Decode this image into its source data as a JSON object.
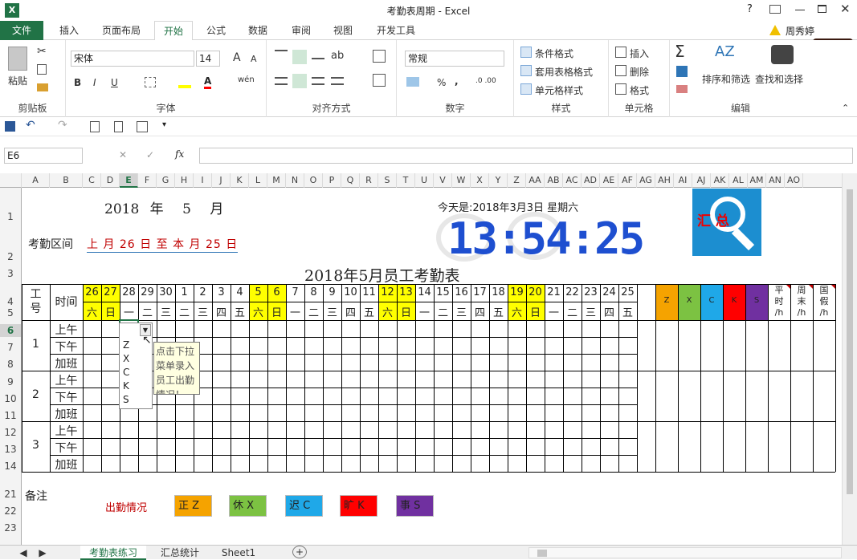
{
  "window": {
    "title": "考勤表周期 - Excel",
    "user": "周秀婷",
    "help": "?",
    "ime_badge": "中。"
  },
  "tabs": [
    "文件",
    "插入",
    "页面布局",
    "开始",
    "公式",
    "数据",
    "审阅",
    "视图",
    "开发工具"
  ],
  "ribbon": {
    "clipboard": {
      "label": "剪贴板",
      "paste": "粘贴"
    },
    "font": {
      "label": "字体",
      "name": "宋体",
      "size": "14",
      "bold": "B",
      "italic": "I",
      "underline": "U",
      "grow": "A",
      "shrink": "A",
      "phonetic": "wén"
    },
    "align": {
      "label": "对齐方式"
    },
    "number": {
      "label": "数字",
      "format": "常规",
      "percent": "%",
      "comma": ","
    },
    "styles": {
      "label": "样式",
      "cond": "条件格式",
      "table": "套用表格格式",
      "cell": "单元格样式"
    },
    "cells": {
      "label": "单元格",
      "insert": "插入",
      "delete": "删除",
      "format": "格式"
    },
    "edit": {
      "label": "编辑",
      "sort": "排序和筛选",
      "find": "查找和选择"
    }
  },
  "formula_bar": {
    "name_box": "E6",
    "fx": "fx",
    "value": ""
  },
  "columns": [
    "A",
    "B",
    "C",
    "D",
    "E",
    "F",
    "G",
    "H",
    "I",
    "J",
    "K",
    "L",
    "M",
    "N",
    "O",
    "P",
    "Q",
    "R",
    "S",
    "T",
    "U",
    "V",
    "W",
    "X",
    "Y",
    "Z",
    "AA",
    "AB",
    "AC",
    "AD",
    "AE",
    "AF",
    "AG",
    "AH",
    "AI",
    "AJ",
    "AK",
    "AL",
    "AM",
    "AN",
    "AO"
  ],
  "rows": [
    "1",
    "2",
    "3",
    "4",
    "5",
    "6",
    "7",
    "8",
    "9",
    "10",
    "11",
    "12",
    "13",
    "14",
    "21",
    "22",
    "23"
  ],
  "selected": {
    "col": "E",
    "row": "6"
  },
  "sheet": {
    "year_line": {
      "year": "2018",
      "year_unit": "年",
      "month": "5",
      "month_unit": "月"
    },
    "today": "今天是:2018年3月3日 星期六",
    "clock": "13:54:25",
    "period_label": "考勤区间",
    "period_value": "上 月 26 日 至 本 月 25 日",
    "logo_text": "汇 总",
    "title": "2018年5月员工考勤表",
    "hdr_id": "工\n号",
    "hdr_time": "时间",
    "days": [
      "26",
      "27",
      "28",
      "29",
      "30",
      "1",
      "2",
      "3",
      "4",
      "5",
      "6",
      "7",
      "8",
      "9",
      "10",
      "11",
      "12",
      "13",
      "14",
      "15",
      "16",
      "17",
      "18",
      "19",
      "20",
      "21",
      "22",
      "23",
      "24",
      "25"
    ],
    "weekdays": [
      "六",
      "日",
      "一",
      "二",
      "三",
      "二",
      "三",
      "四",
      "五",
      "六",
      "日",
      "一",
      "二",
      "三",
      "四",
      "五",
      "六",
      "日",
      "一",
      "二",
      "三",
      "四",
      "五",
      "六",
      "日",
      "一",
      "二",
      "三",
      "四",
      "五"
    ],
    "sum_cols": [
      "Z",
      "X",
      "C",
      "K",
      "S"
    ],
    "sum_colors": [
      "#f5a300",
      "#7cc242",
      "#1fa8e8",
      "#ff0000",
      "#7030a0"
    ],
    "extra_cols": [
      "平\n时\n/h",
      "周\n末\n/h",
      "国\n假\n/h"
    ],
    "employees": [
      "1",
      "2",
      "3"
    ],
    "periods": [
      "上午",
      "下午",
      "加班"
    ],
    "dropdown": [
      "Z",
      "X",
      "C",
      "K",
      "S"
    ],
    "tooltip": "点击下拉菜单录入员工出勤情况！",
    "remark": "备注",
    "legend_label": "出勤情况",
    "legend": [
      {
        "text": "正 Z",
        "color": "#f5a300"
      },
      {
        "text": "休 X",
        "color": "#7cc242"
      },
      {
        "text": "迟 C",
        "color": "#1fa8e8"
      },
      {
        "text": "旷 K",
        "color": "#ff0000"
      },
      {
        "text": "事 S",
        "color": "#7030a0"
      }
    ]
  },
  "sheet_tabs": [
    "考勤表练习",
    "汇总统计",
    "Sheet1"
  ],
  "accent": "#217346"
}
